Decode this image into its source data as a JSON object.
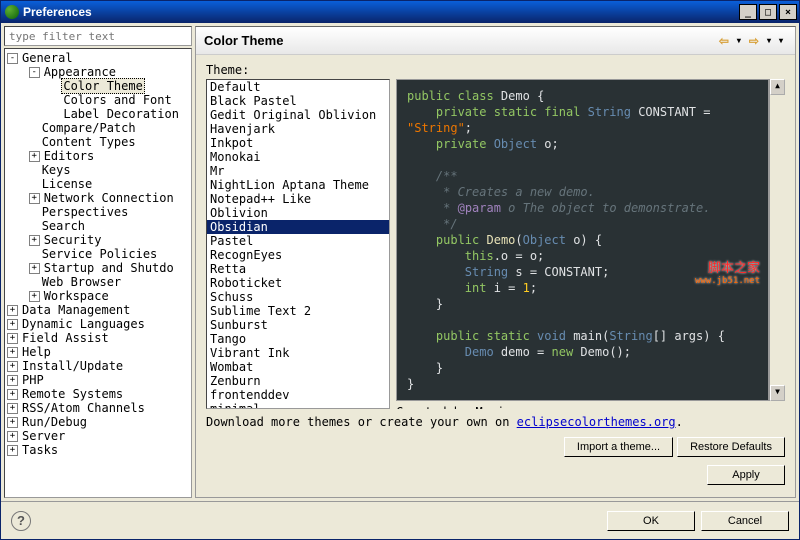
{
  "window": {
    "title": "Preferences"
  },
  "filter": {
    "placeholder": "type filter text"
  },
  "tree": [
    {
      "indent": 0,
      "exp": "-",
      "label": "General"
    },
    {
      "indent": 1,
      "exp": "-",
      "label": "Appearance"
    },
    {
      "indent": 2,
      "exp": "",
      "label": "Color Theme",
      "selected": true
    },
    {
      "indent": 2,
      "exp": "",
      "label": "Colors and Font"
    },
    {
      "indent": 2,
      "exp": "",
      "label": "Label Decoration"
    },
    {
      "indent": 1,
      "exp": "",
      "label": "Compare/Patch"
    },
    {
      "indent": 1,
      "exp": "",
      "label": "Content Types"
    },
    {
      "indent": 1,
      "exp": "+",
      "label": "Editors"
    },
    {
      "indent": 1,
      "exp": "",
      "label": "Keys"
    },
    {
      "indent": 1,
      "exp": "",
      "label": "License"
    },
    {
      "indent": 1,
      "exp": "+",
      "label": "Network Connection"
    },
    {
      "indent": 1,
      "exp": "",
      "label": "Perspectives"
    },
    {
      "indent": 1,
      "exp": "",
      "label": "Search"
    },
    {
      "indent": 1,
      "exp": "+",
      "label": "Security"
    },
    {
      "indent": 1,
      "exp": "",
      "label": "Service Policies"
    },
    {
      "indent": 1,
      "exp": "+",
      "label": "Startup and Shutdo"
    },
    {
      "indent": 1,
      "exp": "",
      "label": "Web Browser"
    },
    {
      "indent": 1,
      "exp": "+",
      "label": "Workspace"
    },
    {
      "indent": 0,
      "exp": "+",
      "label": "Data Management"
    },
    {
      "indent": 0,
      "exp": "+",
      "label": "Dynamic Languages"
    },
    {
      "indent": 0,
      "exp": "+",
      "label": "Field Assist"
    },
    {
      "indent": 0,
      "exp": "+",
      "label": "Help"
    },
    {
      "indent": 0,
      "exp": "+",
      "label": "Install/Update"
    },
    {
      "indent": 0,
      "exp": "+",
      "label": "PHP"
    },
    {
      "indent": 0,
      "exp": "+",
      "label": "Remote Systems"
    },
    {
      "indent": 0,
      "exp": "+",
      "label": "RSS/Atom Channels"
    },
    {
      "indent": 0,
      "exp": "+",
      "label": "Run/Debug"
    },
    {
      "indent": 0,
      "exp": "+",
      "label": "Server"
    },
    {
      "indent": 0,
      "exp": "+",
      "label": "Tasks"
    }
  ],
  "section": {
    "title": "Color Theme",
    "theme_label": "Theme:"
  },
  "themes": [
    "Default",
    "Black Pastel",
    "Gedit Original Oblivion",
    "Havenjark",
    "Inkpot",
    "Monokai",
    "Mr",
    "NightLion Aptana Theme",
    "Notepad++ Like",
    "Oblivion",
    "Obsidian",
    "Pastel",
    "RecognEyes",
    "Retta",
    "Roboticket",
    "Schuss",
    "Sublime Text 2",
    "Sunburst",
    "Tango",
    "Vibrant Ink",
    "Wombat",
    "Zenburn",
    "frontenddev",
    "minimal"
  ],
  "selected_theme": "Obsidian",
  "author_line": "Created by Morinar",
  "download": {
    "prefix": "Download more themes or create your own on ",
    "link_text": "eclipsecolorthemes.org",
    "suffix": "."
  },
  "buttons": {
    "import": "Import a theme...",
    "restore": "Restore Defaults",
    "apply": "Apply",
    "ok": "OK",
    "cancel": "Cancel"
  },
  "watermark": {
    "line1": "脚本之家",
    "line2": "www.jb51.net"
  },
  "code": {
    "l1a": "public class",
    "l1b": " Demo ",
    "l1c": "{",
    "l2a": "private static final",
    "l2b": " String ",
    "l2c": "CONSTANT ",
    "l2d": "=",
    "l3": "\"String\"",
    "l3b": ";",
    "l4a": "private",
    "l4b": " Object ",
    "l4c": "o;",
    "c1": "/**",
    "c2": " * Creates a new demo.",
    "c3a": " * ",
    "c3b": "@param",
    "c3c": " o The object to demonstrate.",
    "c4": " */",
    "l5a": "public",
    "l5b": " Demo",
    "l5c": "(",
    "l5d": "Object ",
    "l5e": "o) {",
    "l6a": "this",
    "l6b": ".o = o;",
    "l7a": "String ",
    "l7b": "s = CONSTANT;",
    "l8a": "int ",
    "l8b": "i = ",
    "l8c": "1",
    "l8d": ";",
    "l9": "}",
    "l10a": "public static",
    "l10b": " void ",
    "l10c": "main",
    "l10d": "(",
    "l10e": "String",
    "l10f": "[] args) {",
    "l11a": "Demo ",
    "l11b": "demo = ",
    "l11c": "new",
    "l11d": " Demo",
    "l11e": "();",
    "l12": "}",
    "l13": "}"
  }
}
